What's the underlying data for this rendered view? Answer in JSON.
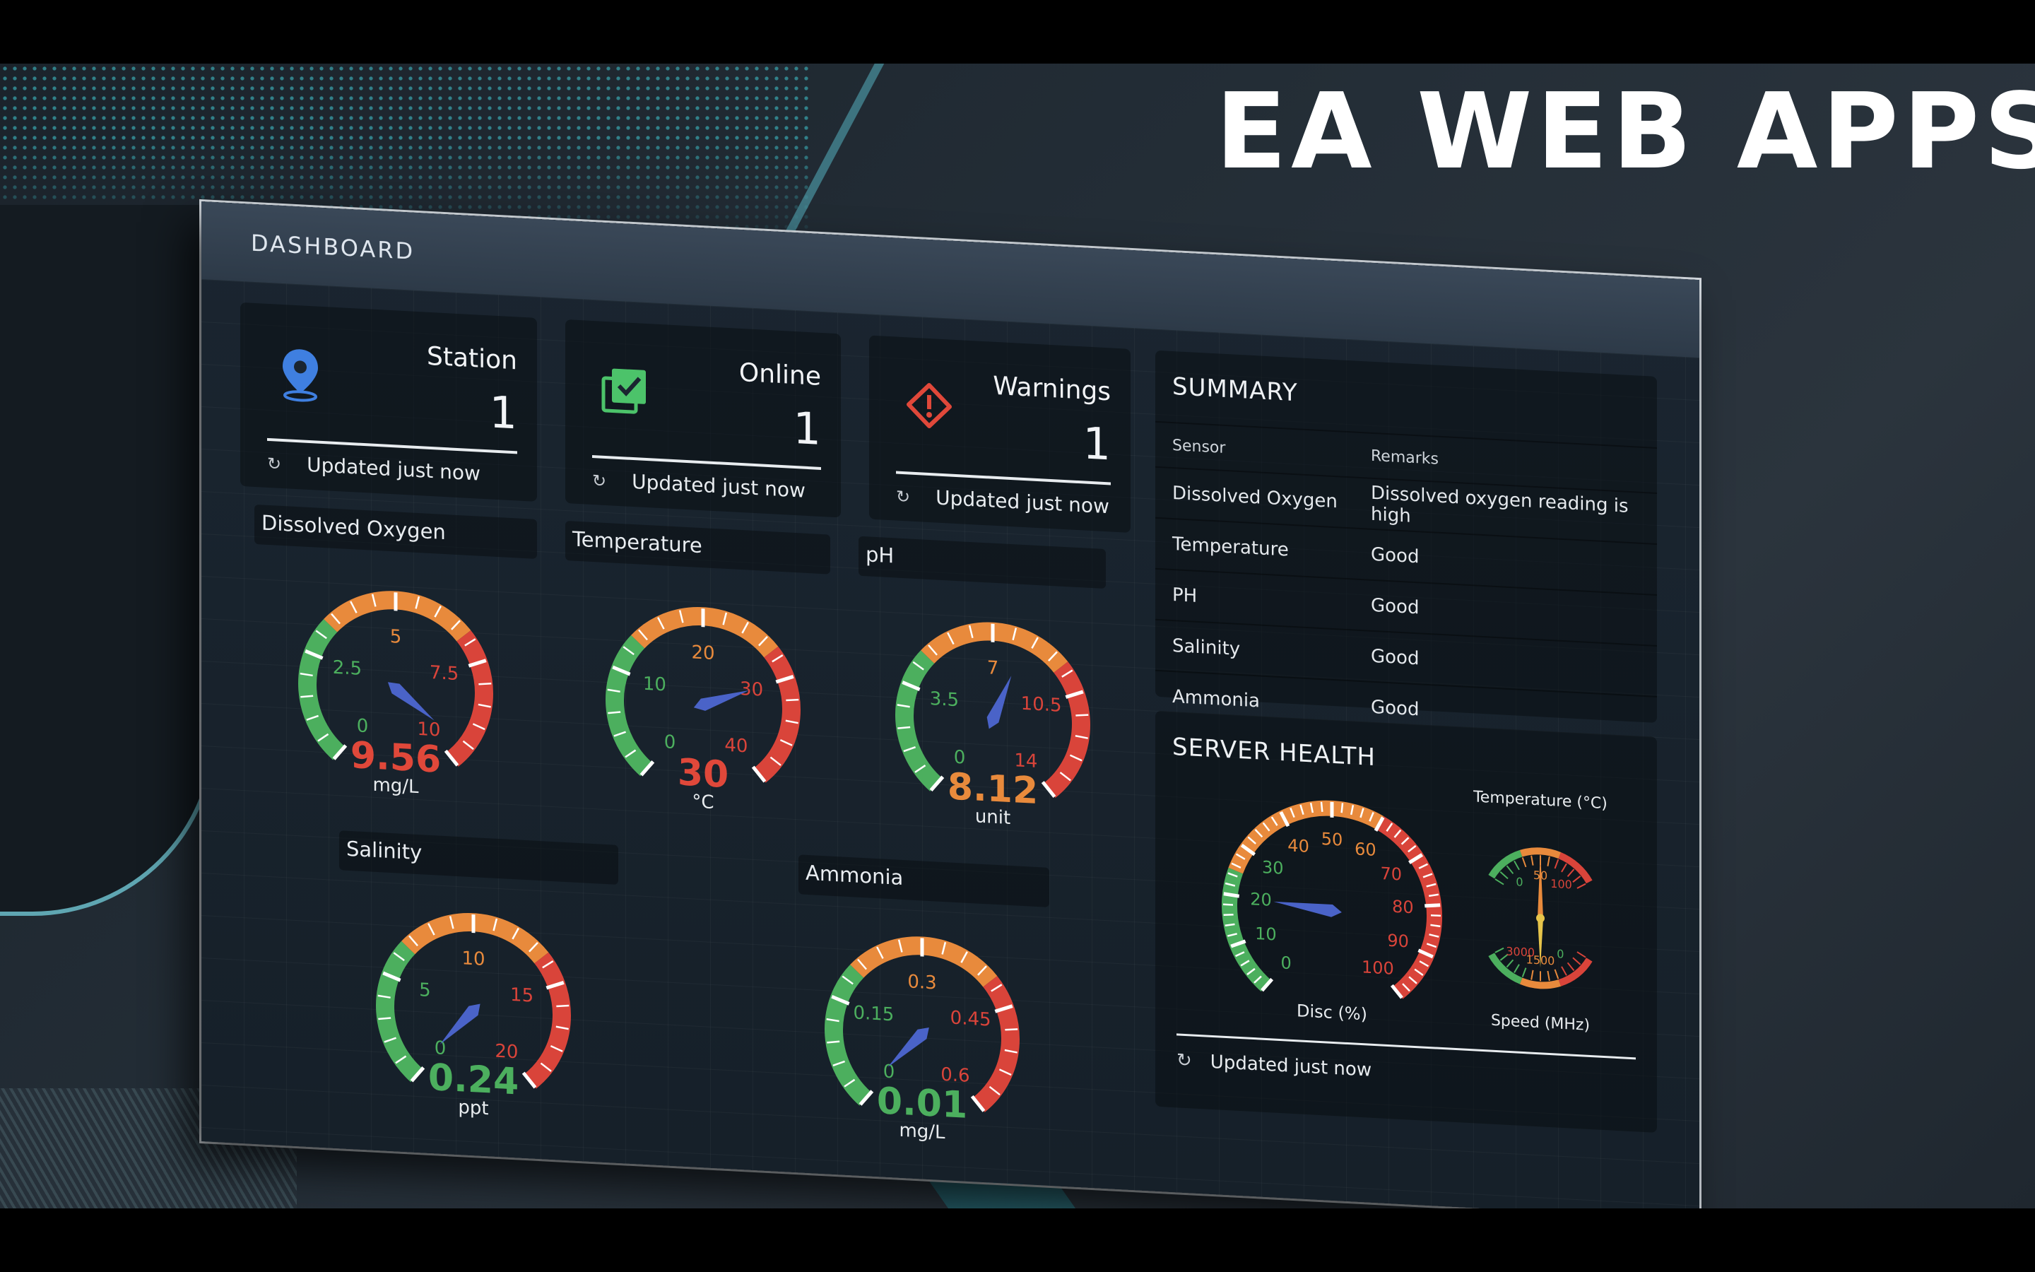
{
  "brand": "EA WEB APPS",
  "dashboard": {
    "title": "DASHBOARD"
  },
  "stats": [
    {
      "title": "Station",
      "value": "1",
      "updated": "Updated just now",
      "icon": "map-pin-icon",
      "color": "#3f7fe0"
    },
    {
      "title": "Online",
      "value": "1",
      "updated": "Updated just now",
      "icon": "checkbox-stack-icon",
      "color": "#4cc36a"
    },
    {
      "title": "Warnings",
      "value": "1",
      "updated": "Updated just now",
      "icon": "warning-diamond-icon",
      "color": "#e0483a"
    }
  ],
  "gauges": [
    {
      "name": "Dissolved Oxygen",
      "value": 9.56,
      "display": "9.56",
      "unit": "mg/L",
      "min": 0,
      "max": 10,
      "ticks": [
        "0",
        "2.5",
        "5",
        "7.5",
        "10"
      ],
      "value_color": "#e0483a"
    },
    {
      "name": "Temperature",
      "value": 30,
      "display": "30",
      "unit": "°C",
      "min": 0,
      "max": 40,
      "ticks": [
        "0",
        "10",
        "20",
        "30",
        "40"
      ],
      "value_color": "#e0483a"
    },
    {
      "name": "pH",
      "value": 8.12,
      "display": "8.12",
      "unit": "unit",
      "min": 0,
      "max": 14,
      "ticks": [
        "0",
        "3.5",
        "7",
        "10.5",
        "14"
      ],
      "value_color": "#e88a3c"
    },
    {
      "name": "Salinity",
      "value": 0.24,
      "display": "0.24",
      "unit": "ppt",
      "min": 0,
      "max": 20,
      "ticks": [
        "0",
        "5",
        "10",
        "15",
        "20"
      ],
      "value_color": "#4caf5e"
    },
    {
      "name": "Ammonia",
      "value": 0.01,
      "display": "0.01",
      "unit": "mg/L",
      "min": 0,
      "max": 0.6,
      "ticks": [
        "0",
        "0.15",
        "0.3",
        "0.45",
        "0.6"
      ],
      "value_color": "#4caf5e"
    }
  ],
  "summary": {
    "title": "SUMMARY",
    "headers": [
      "Sensor",
      "Remarks"
    ],
    "rows": [
      [
        "Dissolved Oxygen",
        "Dissolved oxygen reading is high"
      ],
      [
        "Temperature",
        "Good"
      ],
      [
        "PH",
        "Good"
      ],
      [
        "Salinity",
        "Good"
      ],
      [
        "Ammonia",
        "Good"
      ]
    ]
  },
  "server": {
    "title": "SERVER HEALTH",
    "disc": {
      "label": "Disc (%)",
      "value": 20,
      "min": 0,
      "max": 100,
      "ticks": [
        "0",
        "10",
        "20",
        "30",
        "40",
        "50",
        "60",
        "70",
        "80",
        "90",
        "100"
      ]
    },
    "temperature": {
      "label": "Temperature (°C)",
      "value": 50,
      "ticks": [
        "0",
        "50",
        "100"
      ]
    },
    "speed": {
      "label": "Speed (MHz)",
      "value": 1500,
      "ticks": [
        "3000",
        "1500",
        "0"
      ]
    },
    "updated": "Updated just now"
  },
  "colors": {
    "green": "#4caf5e",
    "orange": "#e88a3c",
    "red": "#d9443a",
    "needle": "#4a63c8"
  }
}
